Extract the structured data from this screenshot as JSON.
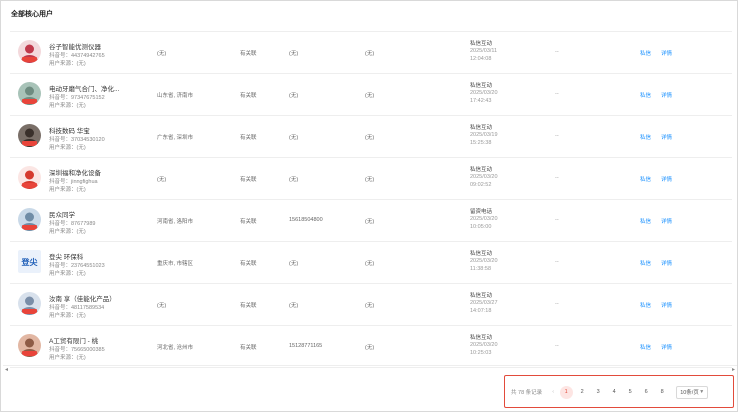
{
  "panel": {
    "title": "全部核心用户"
  },
  "columns_actions": {
    "link1": "私信",
    "link2": "详情"
  },
  "rows": [
    {
      "nick": "谷子智能优测仪器",
      "wx": "抖音号：44374942765",
      "src": "用户来源：(无)",
      "region": "(无)",
      "wechat": "有关联",
      "phone": "(无)",
      "note": "(无)",
      "act": "私信互动",
      "date": "2025/03/11",
      "time": "12:04:08",
      "dash": "--"
    },
    {
      "nick": "电动牙磨气合门、净化...",
      "wx": "抖音号：97347675152",
      "src": "用户来源：(无)",
      "region": "山东省, 济南市",
      "wechat": "有关联",
      "phone": "(无)",
      "note": "(无)",
      "act": "私信互动",
      "date": "2025/03/20",
      "time": "17:42:43",
      "dash": "--"
    },
    {
      "nick": "科技数码 华宝",
      "wx": "抖音号：37034530120",
      "src": "用户来源：(无)",
      "region": "广东省, 深圳市",
      "wechat": "有关联",
      "phone": "(无)",
      "note": "(无)",
      "act": "私信互动",
      "date": "2025/03/19",
      "time": "15:25:38",
      "dash": "--"
    },
    {
      "nick": "深圳福和净化设备",
      "wx": "抖音号：jinngfighua",
      "src": "用户来源：(无)",
      "region": "(无)",
      "wechat": "有关联",
      "phone": "(无)",
      "note": "(无)",
      "act": "私信互动",
      "date": "2025/03/20",
      "time": "09:02:52",
      "dash": "--"
    },
    {
      "nick": "民众同学",
      "wx": "抖音号：87677989",
      "src": "用户来源：(无)",
      "region": "河南省, 洛阳市",
      "wechat": "有关联",
      "phone": "15618504800",
      "note": "(无)",
      "act": "留资电话",
      "date": "2025/03/20",
      "time": "10:05:00",
      "dash": "--"
    },
    {
      "nick": "登尖 环保科",
      "wx": "抖音号：23764551023",
      "src": "用户来源：(无)",
      "region": "重庆市, 市辖区",
      "wechat": "有关联",
      "phone": "(无)",
      "note": "(无)",
      "act": "私信互动",
      "date": "2025/03/20",
      "time": "11:38:58",
      "dash": "--"
    },
    {
      "nick": "汝南 享（佳能化产品）",
      "wx": "抖音号：48117589534",
      "src": "用户来源：(无)",
      "region": "(无)",
      "wechat": "有关联",
      "phone": "(无)",
      "note": "(无)",
      "act": "私信互动",
      "date": "2025/03/27",
      "time": "14:07:18",
      "dash": "--"
    },
    {
      "nick": "A工贸有限门 - 桃",
      "wx": "抖音号：75665000385",
      "src": "用户来源：(无)",
      "region": "河北省, 沧州市",
      "wechat": "有关联",
      "phone": "15128771165",
      "note": "(无)",
      "act": "私信互动",
      "date": "2025/03/20",
      "time": "10:25:03",
      "dash": "--"
    }
  ],
  "avatars": [
    {
      "bg": "#f3d9dc",
      "fg": "#c0394b",
      "name": "avatar-red-label"
    },
    {
      "bg": "#a8c3b8",
      "fg": "#6e8c80",
      "name": "avatar-landscape"
    },
    {
      "bg": "#7a6f68",
      "fg": "#3a302b",
      "name": "avatar-person"
    },
    {
      "bg": "#fbe6e4",
      "fg": "#d53a2e",
      "name": "avatar-logo-red"
    },
    {
      "bg": "#c9d9e8",
      "fg": "#6f8ca6",
      "name": "avatar-sky"
    },
    {
      "bg": "#eaf1fb",
      "fg": "#1f5fb8",
      "name": "avatar-text-logo"
    },
    {
      "bg": "#d8e1ec",
      "fg": "#7a8ea8",
      "name": "avatar-person-blue"
    },
    {
      "bg": "#e2b7a3",
      "fg": "#8e5b45",
      "name": "avatar-portrait"
    }
  ],
  "avatar_logo_text": "登尖",
  "pagination": {
    "total": "共 78 条记录",
    "prev": "‹",
    "pages": [
      "1",
      "2",
      "3",
      "4",
      "5",
      "6",
      "8"
    ],
    "active": "1",
    "page_size": "10条/页"
  },
  "scroll": {
    "left": "◂",
    "right": "▸"
  }
}
